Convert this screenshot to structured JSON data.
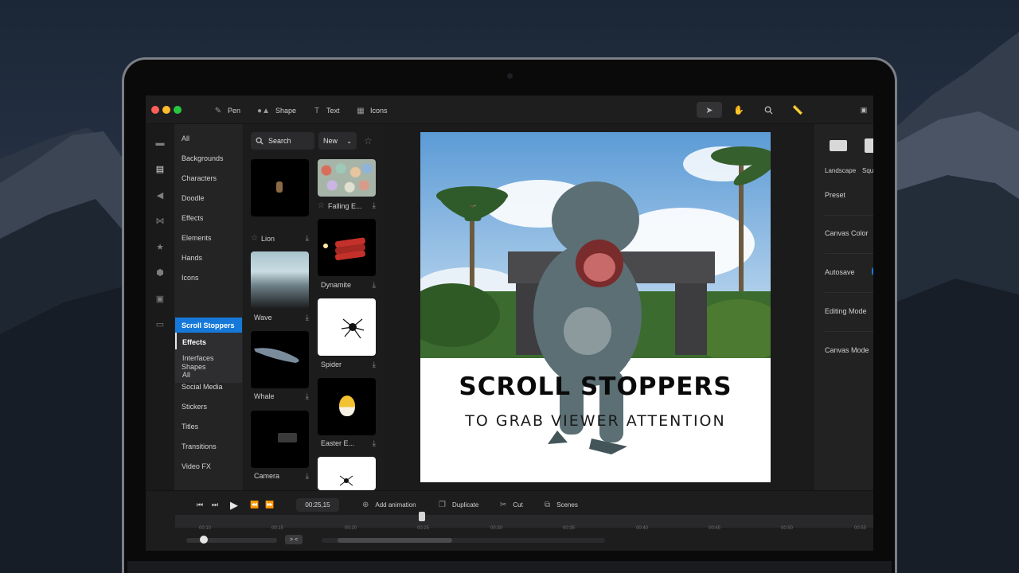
{
  "toolbar": {
    "tools": [
      {
        "label": "Pen",
        "icon": "pen-icon"
      },
      {
        "label": "Shape",
        "icon": "shape-icon"
      },
      {
        "label": "Text",
        "icon": "text-icon"
      },
      {
        "label": "Icons",
        "icon": "icons-grid-icon"
      }
    ],
    "right_tools": [
      "select-arrow-icon",
      "hand-icon",
      "search-icon",
      "ruler-icon",
      "save-icon"
    ]
  },
  "sidebar_icons": [
    "folder-icon",
    "clapper-icon",
    "speaker-icon",
    "bowtie-icon",
    "star-icon",
    "gear-icon",
    "video-icon",
    "keyboard-icon"
  ],
  "categories": {
    "items": [
      "All",
      "Backgrounds",
      "Characters",
      "Doodle",
      "Effects",
      "Elements",
      "Hands",
      "Icons"
    ],
    "active": "Scroll Stoppers",
    "subitems": [
      "Effects",
      "Interfaces",
      "All"
    ],
    "items_after": [
      "Shapes",
      "Social Media",
      "Stickers",
      "Titles",
      "Transitions",
      "Video FX"
    ]
  },
  "assets": {
    "search_placeholder": "Search",
    "sort_value": "New",
    "left_column": [
      "Lion",
      "Wave",
      "Whale",
      "Camera"
    ],
    "right_column": [
      "Falling E...",
      "Dynamite",
      "Spider",
      "Easter E..."
    ]
  },
  "artboard": {
    "headline": "SCROLL STOPPERS",
    "subline": "TO GRAB VIEWER ATTENTION"
  },
  "properties": {
    "orientations": [
      "Landscape",
      "Squa"
    ],
    "rows": [
      "Preset",
      "Canvas Color",
      "Autosave",
      "Editing Mode",
      "Canvas Mode"
    ]
  },
  "timeline": {
    "timecode": "00:25,15",
    "actions": [
      {
        "label": "Add animation",
        "icon": "plus-circle-icon"
      },
      {
        "label": "Duplicate",
        "icon": "duplicate-icon"
      },
      {
        "label": "Cut",
        "icon": "scissors-icon"
      },
      {
        "label": "Scenes",
        "icon": "scenes-icon"
      }
    ],
    "ticks": [
      "00:10",
      "00:15",
      "00:20",
      "00:25",
      "00:30",
      "00:35",
      "00:40",
      "00:45",
      "00:50",
      "00:55"
    ],
    "zoom_label": "> <"
  },
  "colors": {
    "accent": "#1679d9",
    "traffic": [
      "#ff5f57",
      "#febc2e",
      "#28c840"
    ]
  }
}
